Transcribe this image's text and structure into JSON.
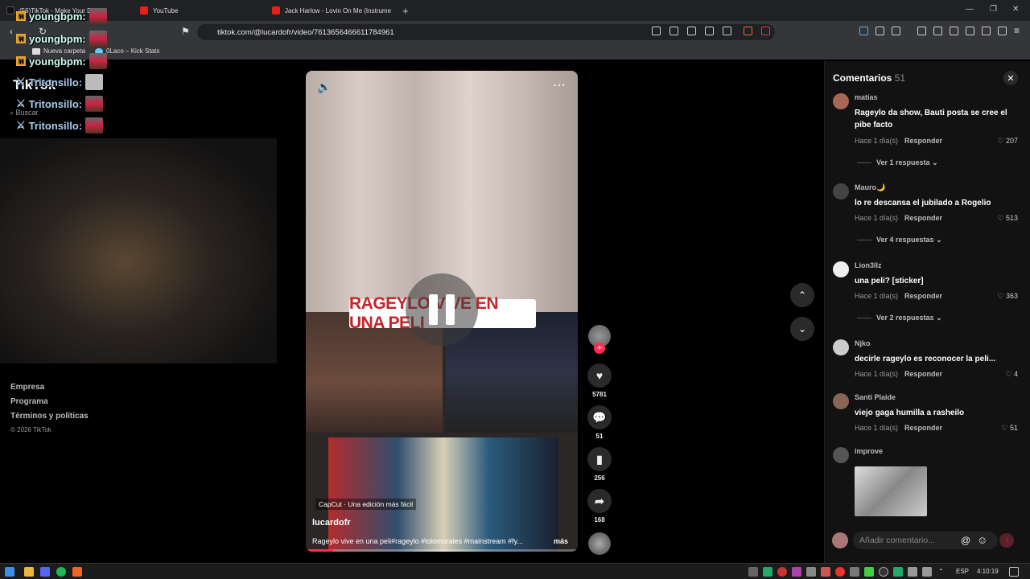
{
  "browser": {
    "tabs": [
      {
        "title": "(56)TikTok - Make Your D",
        "color": "#111"
      },
      {
        "title": "YouTube",
        "color": "#e62117"
      },
      {
        "title": "Jack Harlow - Lovin On Me (Instrume",
        "color": "#e62117"
      }
    ],
    "url": "tiktok.com/@lucardofr/video/7613656466611784961",
    "bookmarks": [
      "Nueva carpeta",
      "0Laco – Kick Stats"
    ]
  },
  "overlay": {
    "chat": [
      {
        "user": "youngbpm:",
        "kind": "yb"
      },
      {
        "user": "youngbpm:",
        "kind": "yb"
      },
      {
        "user": "youngbpm:",
        "kind": "yb"
      },
      {
        "user": "Tritonsillo:",
        "kind": "ts"
      },
      {
        "user": "Tritonsillo:",
        "kind": "ts"
      },
      {
        "user": "Tritonsillo:",
        "kind": "ts"
      }
    ],
    "logo": "TikTok",
    "search_placeholder": "Buscar"
  },
  "footer": {
    "links": [
      "Empresa",
      "Programa",
      "Términos y políticas"
    ],
    "copyright": "© 2026 TikTok"
  },
  "video": {
    "caption": "RAGEYLO VIVE EN UNA PELI",
    "capcut": "CapCut · Una edición más fácil",
    "author": "lucardofr",
    "description": "Rageylo vive en una peli#rageylo #lolomorales #mainstream #fy...",
    "more": "más",
    "progress": 0.1
  },
  "actions": {
    "likes": "5781",
    "comments": "51",
    "saves": "256",
    "shares": "168"
  },
  "comments_panel": {
    "title": "Comentarios",
    "count": "51",
    "input_placeholder": "Añadir comentario...",
    "items": [
      {
        "user": "matías",
        "text": "Rageylo da show, Bauti posta se cree el pibe facto",
        "time": "Hace 1 día(s)",
        "reply": "Responder",
        "likes": "207",
        "replies": "Ver 1 respuesta"
      },
      {
        "user": "Mauro🌙",
        "text": "lo re descansa el jubilado a Rogelio",
        "time": "Hace 1 día(s)",
        "reply": "Responder",
        "likes": "513",
        "replies": "Ver 4 respuestas"
      },
      {
        "user": "Lion3llz",
        "text": "una peli? [sticker]",
        "time": "Hace 1 día(s)",
        "reply": "Responder",
        "likes": "363",
        "replies": "Ver 2 respuestas"
      },
      {
        "user": "Njko",
        "text": "decirle rageylo es reconocer la peli...",
        "time": "Hace 1 día(s)",
        "reply": "Responder",
        "likes": "4",
        "replies": ""
      },
      {
        "user": "Santi Plaide",
        "text": "viejo gaga humilla a rasheilo",
        "time": "Hace 1 día(s)",
        "reply": "Responder",
        "likes": "51",
        "replies": ""
      },
      {
        "user": "improve",
        "text": "",
        "time": "",
        "reply": "",
        "likes": "",
        "replies": ""
      }
    ]
  },
  "taskbar": {
    "lang": "ESP",
    "time": "4:10:19"
  }
}
